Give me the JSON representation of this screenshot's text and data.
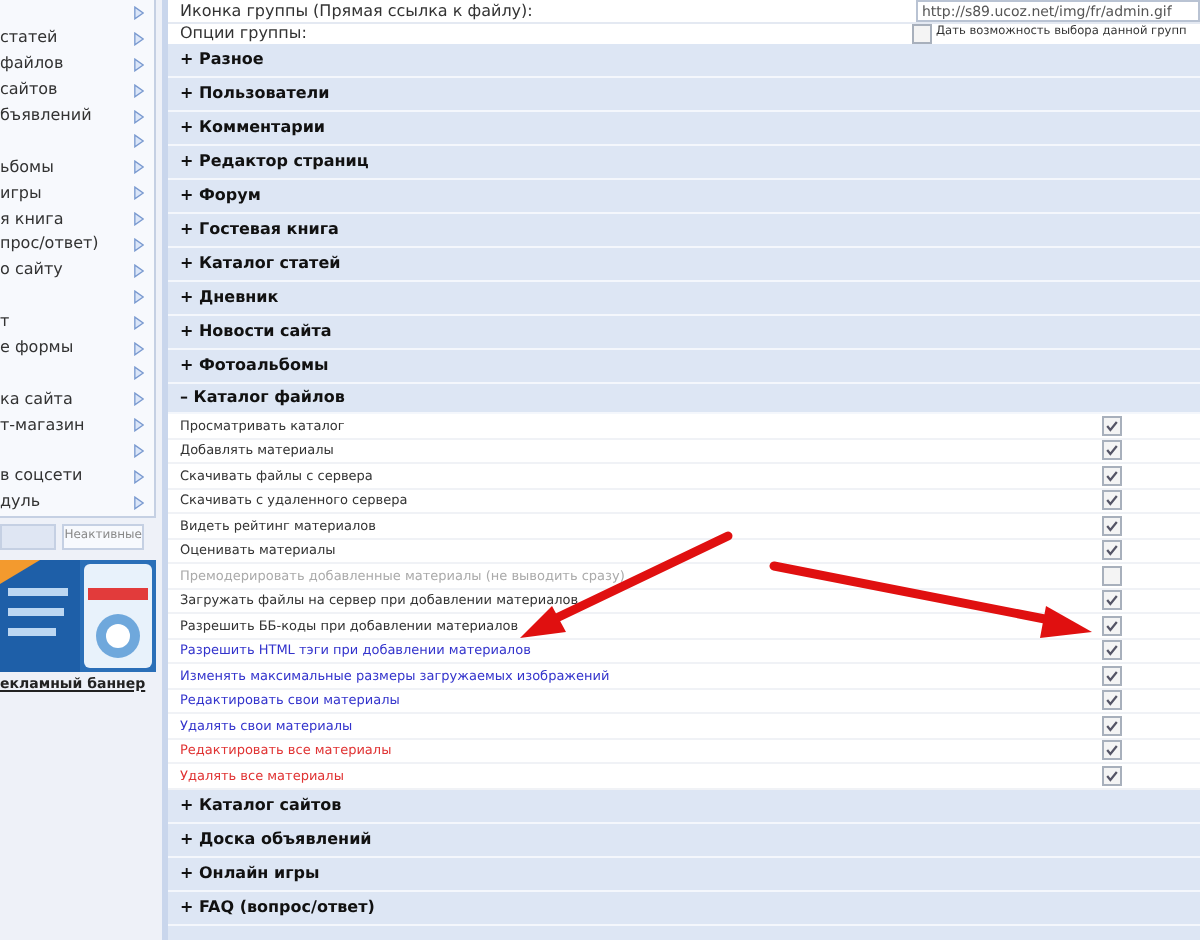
{
  "sidebar": {
    "items": [
      {
        "kind": "blank"
      },
      {
        "kind": "link",
        "label": "статей"
      },
      {
        "kind": "link",
        "label": "файлов"
      },
      {
        "kind": "link",
        "label": "сайтов"
      },
      {
        "kind": "link",
        "label": "бъявлений"
      },
      {
        "kind": "blank"
      },
      {
        "kind": "link",
        "label": "ьбомы"
      },
      {
        "kind": "link",
        "label": "игры"
      },
      {
        "kind": "link",
        "label": "я книга"
      },
      {
        "kind": "link",
        "label": "прос/ответ)"
      },
      {
        "kind": "link",
        "label": "о сайту"
      },
      {
        "kind": "blank"
      },
      {
        "kind": "link",
        "label": "т"
      },
      {
        "kind": "link",
        "label": "е формы"
      },
      {
        "kind": "blank"
      },
      {
        "kind": "link",
        "label": "ка сайта"
      },
      {
        "kind": "link",
        "label": "т-магазин"
      },
      {
        "kind": "blank"
      },
      {
        "kind": "link",
        "label": "в соцсети"
      },
      {
        "kind": "link",
        "label": "дуль"
      }
    ],
    "tabs": [
      {
        "selected": true
      },
      {
        "label": "Неактивные",
        "selected": false
      }
    ],
    "banner_link": "екламный баннер"
  },
  "main": {
    "icon_row": {
      "label": "Иконка группы (Прямая ссылка к файлу):",
      "value": "http://s89.ucoz.net/img/fr/admin.gif"
    },
    "options_row": {
      "label": "Опции группы:",
      "checkbox_label": "Дать возможность выбора данной групп",
      "checked": false
    },
    "sections": [
      {
        "label": "+ Разное",
        "expanded": false
      },
      {
        "label": "+ Пользователи",
        "expanded": false
      },
      {
        "label": "+ Комментарии",
        "expanded": false
      },
      {
        "label": "+ Редактор страниц",
        "expanded": false
      },
      {
        "label": "+ Форум",
        "expanded": false
      },
      {
        "label": "+ Гостевая книга",
        "expanded": false
      },
      {
        "label": "+ Каталог статей",
        "expanded": false
      },
      {
        "label": "+ Дневник",
        "expanded": false
      },
      {
        "label": "+ Новости сайта",
        "expanded": false
      },
      {
        "label": "+ Фотоальбомы",
        "expanded": false
      },
      {
        "label": "– Каталог файлов",
        "expanded": true,
        "permissions": [
          {
            "label": "Просматривать каталог",
            "checked": true,
            "color": "#333333"
          },
          {
            "label": "Добавлять материалы",
            "checked": true,
            "color": "#333333"
          },
          {
            "label": "Скачивать файлы с сервера",
            "checked": true,
            "color": "#333333"
          },
          {
            "label": "Скачивать с удаленного сервера",
            "checked": true,
            "color": "#333333"
          },
          {
            "label": "Видеть рейтинг материалов",
            "checked": true,
            "color": "#333333"
          },
          {
            "label": "Оценивать материалы",
            "checked": true,
            "color": "#333333"
          },
          {
            "label": "Премодерировать добавленные материалы (не выводить сразу)",
            "checked": false,
            "color": "#aaaaaa"
          },
          {
            "label": "Загружать файлы на сервер при добавлении материалов",
            "checked": true,
            "color": "#333333"
          },
          {
            "label": "Разрешить ББ-коды при добавлении материалов",
            "checked": true,
            "color": "#333333"
          },
          {
            "label": "Разрешить HTML тэги при добавлении материалов",
            "checked": true,
            "color": "#3333cc"
          },
          {
            "label": "Изменять максимальные размеры загружаемых изображений",
            "checked": true,
            "color": "#3333cc"
          },
          {
            "label": "Редактировать свои материалы",
            "checked": true,
            "color": "#3333cc"
          },
          {
            "label": "Удалять свои материалы",
            "checked": true,
            "color": "#3333cc"
          },
          {
            "label": "Редактировать все материалы",
            "checked": true,
            "color": "#e03333"
          },
          {
            "label": "Удалять все материалы",
            "checked": true,
            "color": "#e03333"
          }
        ]
      },
      {
        "label": "+ Каталог сайтов",
        "expanded": false
      },
      {
        "label": "+ Доска объявлений",
        "expanded": false
      },
      {
        "label": "+ Онлайн игры",
        "expanded": false
      },
      {
        "label": "+ FAQ (вопрос/ответ)",
        "expanded": false
      }
    ]
  }
}
